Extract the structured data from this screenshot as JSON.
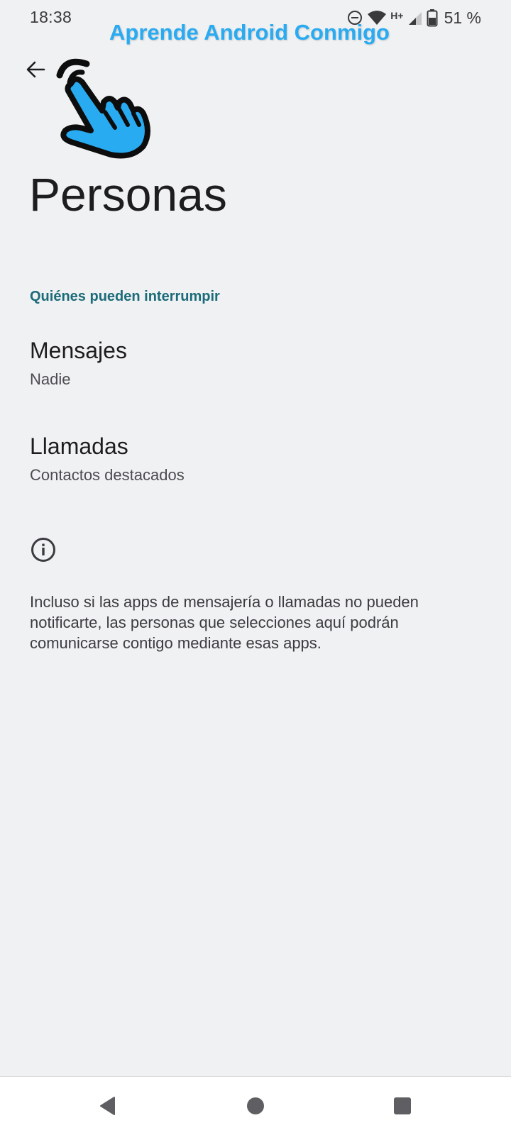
{
  "status_bar": {
    "time": "18:38",
    "network_label": "H+",
    "battery_percent": "51 %",
    "icons": [
      "do-not-disturb-icon",
      "wifi-icon",
      "signal-icon",
      "battery-icon"
    ]
  },
  "watermark": {
    "text": "Aprende Android Conmigo",
    "color": "#29abf1"
  },
  "page": {
    "title": "Personas",
    "section_header": "Quiénes pueden interrumpir",
    "items": [
      {
        "title": "Mensajes",
        "summary": "Nadie"
      },
      {
        "title": "Llamadas",
        "summary": "Contactos destacados"
      }
    ],
    "footer": "Incluso si las apps de mensajería o llamadas no pueden notificarte, las personas que selecciones aquí podrán comunicarse contigo mediante esas apps."
  },
  "colors": {
    "background": "#f0f1f3",
    "accent": "#1b6b78",
    "pointer_blue": "#29abf1"
  },
  "nav_bar": {
    "buttons": [
      "back-icon",
      "home-icon",
      "recents-icon"
    ]
  }
}
